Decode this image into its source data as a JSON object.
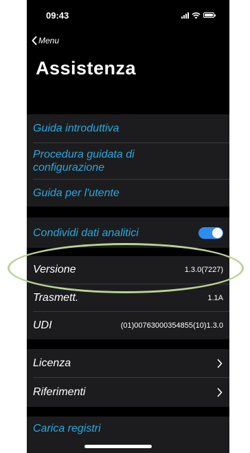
{
  "status_bar": {
    "time": "09:43"
  },
  "nav": {
    "back_label": "Menu",
    "title": "Assistenza"
  },
  "links_group": [
    {
      "label": "Guida introduttiva"
    },
    {
      "label": "Procedura guidata di configurazione",
      "line1": "Procedura guidata di",
      "line2": "configurazione"
    },
    {
      "label": "Guida per l'utente"
    }
  ],
  "analytics": {
    "label": "Condividi dati analitici",
    "toggle_on": true,
    "toggle_color": "#2d8cf0"
  },
  "info": {
    "version": {
      "label": "Versione",
      "value": "1.3.0(7227)"
    },
    "transmitter": {
      "label": "Trasmett.",
      "value": "1.1A"
    },
    "udi": {
      "label": "UDI",
      "value": "(01)00763000354855(10)1.3.0"
    }
  },
  "legal": [
    {
      "label": "Licenza"
    },
    {
      "label": "Riferimenti"
    }
  ],
  "upload_logs": {
    "label": "Carica registri"
  },
  "colors": {
    "link": "#2aa9df",
    "background": "#000000",
    "cell": "#1c1c1e",
    "highlight": "#b9d394"
  }
}
